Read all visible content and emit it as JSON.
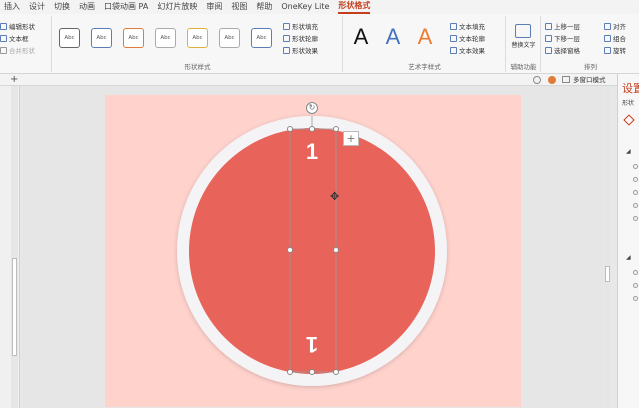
{
  "menu": [
    "插入",
    "设计",
    "切换",
    "动画",
    "口袋动画 PA",
    "幻灯片放映",
    "审阅",
    "视图",
    "帮助",
    "OneKey Lite",
    "形状格式"
  ],
  "insert_shapes": {
    "edit_shape": "编辑形状",
    "text_box": "文本框",
    "merge_shapes": "合并形状"
  },
  "shape_styles": {
    "label": "形状样式",
    "swatch_text": "Abc",
    "fill": "形状填充",
    "outline": "形状轮廓",
    "effect": "形状效果"
  },
  "wordart": {
    "label": "艺术字样式",
    "letter": "A",
    "text_fill": "文本填充",
    "text_outline": "文本轮廓",
    "text_effect": "文本效果",
    "colors": [
      "#111111",
      "#4472c4",
      "#ed7d31"
    ]
  },
  "accessibility": {
    "label": "辅助功能",
    "alt_text": "替换文字"
  },
  "arrange": {
    "label": "排列",
    "bring_forward": "上移一层",
    "send_backward": "下移一层",
    "selection_pane": "选择窗格",
    "align": "对齐",
    "group": "组合",
    "rotate": "旋转"
  },
  "toolbar": {
    "multi_window": "多窗口模式"
  },
  "task_pane": {
    "title": "设置",
    "subtitle": "形状"
  },
  "slide": {
    "background": "#ffd2cc",
    "circle_fill": "#e8635a",
    "ring_color": "#f4f4f7",
    "top_mark": "1",
    "bottom_mark": "1"
  }
}
